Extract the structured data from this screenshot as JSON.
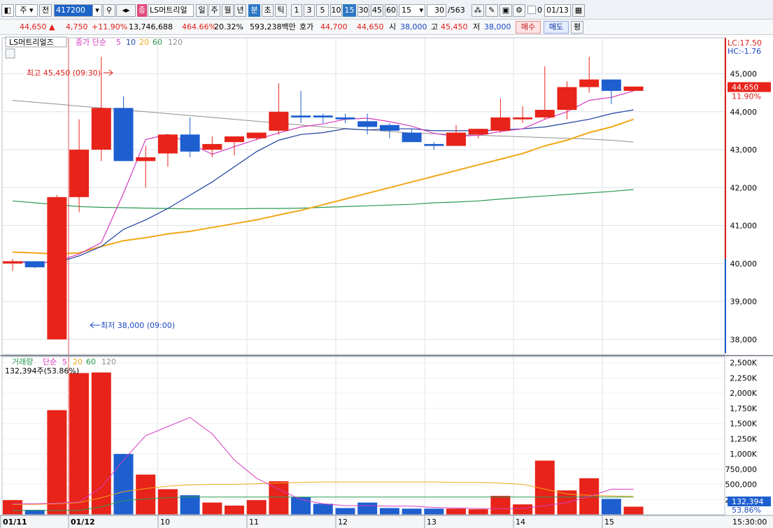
{
  "toolbar": {
    "mode": "주",
    "period_btn": "전",
    "code": "417200",
    "sector_badge": "종",
    "name": "LS머트리얼",
    "period_tabs": [
      "일",
      "주",
      "월",
      "년",
      "분",
      "초",
      "틱"
    ],
    "active_period": "분",
    "intervals": [
      "1",
      "3",
      "5",
      "10",
      "15",
      "30",
      "45",
      "60"
    ],
    "active_interval": "15",
    "interval_select": "15",
    "count": "30",
    "count_total": "/563",
    "date_checkbox_label": "0",
    "date_value": "01/13"
  },
  "quote": {
    "price": "44,650",
    "change": "4,750",
    "change_pct": "+11.90%",
    "volume": "13,746,688",
    "vol_ratio": "464.66%",
    "turnover": "20.32%",
    "amount": "593,238백만",
    "bid_label": "호가",
    "bid": "44,700",
    "ask": "44,650",
    "open_label": "시",
    "open": "38,000",
    "high_label": "고",
    "high": "45,450",
    "low_label": "저",
    "low": "38,000",
    "buy": "매수",
    "sell": "매도",
    "avg": "평"
  },
  "price_panel": {
    "legend_name": "LS머트리얼즈",
    "legend_type": "종가 단순",
    "ma": [
      "5",
      "10",
      "20",
      "60",
      "120"
    ],
    "high_note": "최고 45,450 (09:30)",
    "low_note": "최저 38,000 (09:00)",
    "lc": "LC:17.50",
    "hc": "HC:-1.76",
    "current_price": "44,650",
    "current_pct": "11.90%",
    "y_ticks": [
      "45,000",
      "44,000",
      "43,000",
      "42,000",
      "41,000",
      "40,000",
      "39,000",
      "38,000"
    ]
  },
  "volume_panel": {
    "legend_name": "거래량",
    "legend_type": "단순",
    "ma": [
      "5",
      "20",
      "60",
      "120"
    ],
    "info": "132,394주(53.86%)",
    "current": "132,394",
    "current_pct": "53.86%",
    "y_ticks": [
      "2,500K",
      "2,250K",
      "2,000K",
      "1,750K",
      "1,500K",
      "1,250K",
      "1,000K",
      "750,000",
      "500,000",
      "250,000"
    ]
  },
  "x_labels": [
    "01/11",
    "01/12",
    "10",
    "11",
    "12",
    "13",
    "14",
    "15"
  ],
  "time_label": "15:30:00",
  "colors": {
    "up": "#e8231a",
    "down": "#1e5fd0",
    "ma5": "#d63cc0",
    "ma10": "#1e3fa0",
    "ma20": "#f0a818",
    "ma60": "#2a9a50",
    "ma120": "#909090"
  },
  "chart_data": {
    "type": "candlestick",
    "ohlc": [
      [
        40060,
        40120,
        39800,
        40000
      ],
      [
        40060,
        40060,
        39880,
        39900
      ],
      [
        38000,
        41800,
        38000,
        41750
      ],
      [
        41750,
        43800,
        41350,
        43000
      ],
      [
        43000,
        45450,
        42700,
        44100
      ],
      [
        44100,
        44400,
        42700,
        42700
      ],
      [
        42700,
        43100,
        42000,
        42800
      ],
      [
        42900,
        43400,
        42550,
        43400
      ],
      [
        43400,
        43850,
        42800,
        42950
      ],
      [
        43000,
        43350,
        42800,
        43150
      ],
      [
        43200,
        43300,
        42850,
        43350
      ],
      [
        43300,
        43450,
        43250,
        43450
      ],
      [
        43500,
        44750,
        43400,
        44000
      ],
      [
        43900,
        44550,
        43700,
        43850
      ],
      [
        43850,
        43950,
        43700,
        43900
      ],
      [
        43850,
        43950,
        43700,
        43800
      ],
      [
        43750,
        43950,
        43400,
        43600
      ],
      [
        43650,
        43700,
        43300,
        43500
      ],
      [
        43450,
        43550,
        43250,
        43200
      ],
      [
        43150,
        43200,
        43000,
        43100
      ],
      [
        43100,
        43650,
        43100,
        43450
      ],
      [
        43400,
        43550,
        43300,
        43550
      ],
      [
        43500,
        44350,
        43450,
        43850
      ],
      [
        43800,
        44150,
        43700,
        43850
      ],
      [
        43850,
        45200,
        43800,
        44050
      ],
      [
        44050,
        44800,
        43800,
        44650
      ],
      [
        44650,
        45450,
        44500,
        44850
      ],
      [
        44850,
        44850,
        44200,
        44550
      ],
      [
        44550,
        44650,
        44550,
        44650
      ]
    ],
    "volumes": [
      240000,
      80000,
      1720000,
      2330000,
      2340000,
      1000000,
      660000,
      420000,
      320000,
      200000,
      150000,
      240000,
      550000,
      290000,
      180000,
      110000,
      200000,
      110000,
      100000,
      100000,
      100000,
      90000,
      310000,
      170000,
      890000,
      400000,
      600000,
      260000,
      132394
    ],
    "up": [
      true,
      false,
      true,
      true,
      true,
      false,
      true,
      true,
      false,
      true,
      true,
      true,
      true,
      false,
      false,
      false,
      false,
      false,
      false,
      false,
      true,
      true,
      true,
      true,
      true,
      true,
      true,
      false,
      true
    ],
    "ma5": [
      40040,
      40020,
      40050,
      40250,
      40550,
      41850,
      43270,
      43400,
      43170,
      42880,
      43080,
      43270,
      43440,
      43600,
      43680,
      43800,
      43830,
      43740,
      43620,
      43430,
      43350,
      43380,
      43480,
      43550,
      43800,
      44000,
      44300,
      44380,
      44550
    ],
    "ma10": [
      40050,
      40040,
      40020,
      40200,
      40450,
      40900,
      41150,
      41450,
      41800,
      42150,
      42550,
      42950,
      43250,
      43400,
      43450,
      43550,
      43520,
      43550,
      43550,
      43500,
      43500,
      43500,
      43520,
      43550,
      43600,
      43700,
      43800,
      43950,
      44050
    ],
    "ma20": [
      40300,
      40280,
      40250,
      40280,
      40450,
      40600,
      40680,
      40780,
      40850,
      40950,
      41050,
      41150,
      41280,
      41400,
      41550,
      41700,
      41850,
      42000,
      42150,
      42300,
      42450,
      42600,
      42750,
      42900,
      43100,
      43250,
      43450,
      43600,
      43800
    ],
    "ma60": [
      41650,
      41600,
      41550,
      41500,
      41480,
      41470,
      41460,
      41450,
      41440,
      41440,
      41440,
      41450,
      41450,
      41460,
      41480,
      41500,
      41520,
      41540,
      41560,
      41600,
      41620,
      41650,
      41700,
      41740,
      41780,
      41820,
      41860,
      41900,
      41950
    ],
    "ma120": [
      44300,
      44250,
      44200,
      44150,
      44100,
      44050,
      44000,
      43950,
      43900,
      43850,
      43800,
      43750,
      43700,
      43650,
      43600,
      43560,
      43520,
      43480,
      43440,
      43420,
      43400,
      43380,
      43360,
      43340,
      43320,
      43300,
      43280,
      43250,
      43200
    ],
    "vol_ma5": [
      180000,
      180000,
      190000,
      210000,
      450000,
      900000,
      1300000,
      1450000,
      1600000,
      1330000,
      900000,
      600000,
      420000,
      250000,
      180000,
      150000,
      150000,
      140000,
      140000,
      120000,
      110000,
      100000,
      100000,
      100000,
      150000,
      200000,
      300000,
      420000,
      420000
    ],
    "vol_ma20": [
      170000,
      170000,
      180000,
      200000,
      280000,
      380000,
      430000,
      470000,
      490000,
      500000,
      500000,
      510000,
      520000,
      530000,
      540000,
      540000,
      540000,
      540000,
      540000,
      540000,
      530000,
      530000,
      520000,
      500000,
      420000,
      340000,
      320000,
      310000,
      300000
    ],
    "vol_ma60": [
      70000,
      70000,
      70000,
      70000,
      130000,
      230000,
      260000,
      280000,
      290000,
      290000,
      290000,
      290000,
      290000,
      290000,
      290000,
      290000,
      290000,
      290000,
      290000,
      290000,
      290000,
      290000,
      290000,
      290000,
      290000,
      290000,
      290000,
      290000,
      290000
    ],
    "price_ylim": [
      37600,
      45950
    ],
    "volume_ylim": [
      0,
      2600000
    ]
  }
}
